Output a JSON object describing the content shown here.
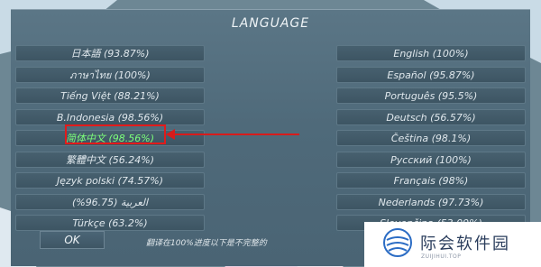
{
  "dialog": {
    "title": "LANGUAGE",
    "ok_label": "OK",
    "note": "翻译在100%进度以下是不完整的"
  },
  "languages_left": [
    "日本語 (93.87%)",
    "ภาษาไทย (100%)",
    "Tiếng Việt (88.21%)",
    "B.Indonesia (98.56%)",
    "简体中文 (98.56%)",
    "繁體中文 (56.24%)",
    "Język polski (74.57%)",
    "العربية (96.75%)",
    "Türkçe (63.2%)"
  ],
  "languages_right": [
    "English (100%)",
    "Español (95.87%)",
    "Português (95.5%)",
    "Deutsch (56.57%)",
    "Čeština (98.1%)",
    "Русский (100%)",
    "Français (98%)",
    "Nederlands (97.73%)",
    "Slovenčina (53.09%)"
  ],
  "selected_language": "简体中文 (98.56%)",
  "watermark": {
    "text": "际会软件园",
    "sub": "ZUIJIHUI.TOP"
  },
  "colors": {
    "panel": "#4f6a7a",
    "button": "#3d5563",
    "selected_text": "#7dff7a",
    "annotation": "#e21b1b"
  }
}
